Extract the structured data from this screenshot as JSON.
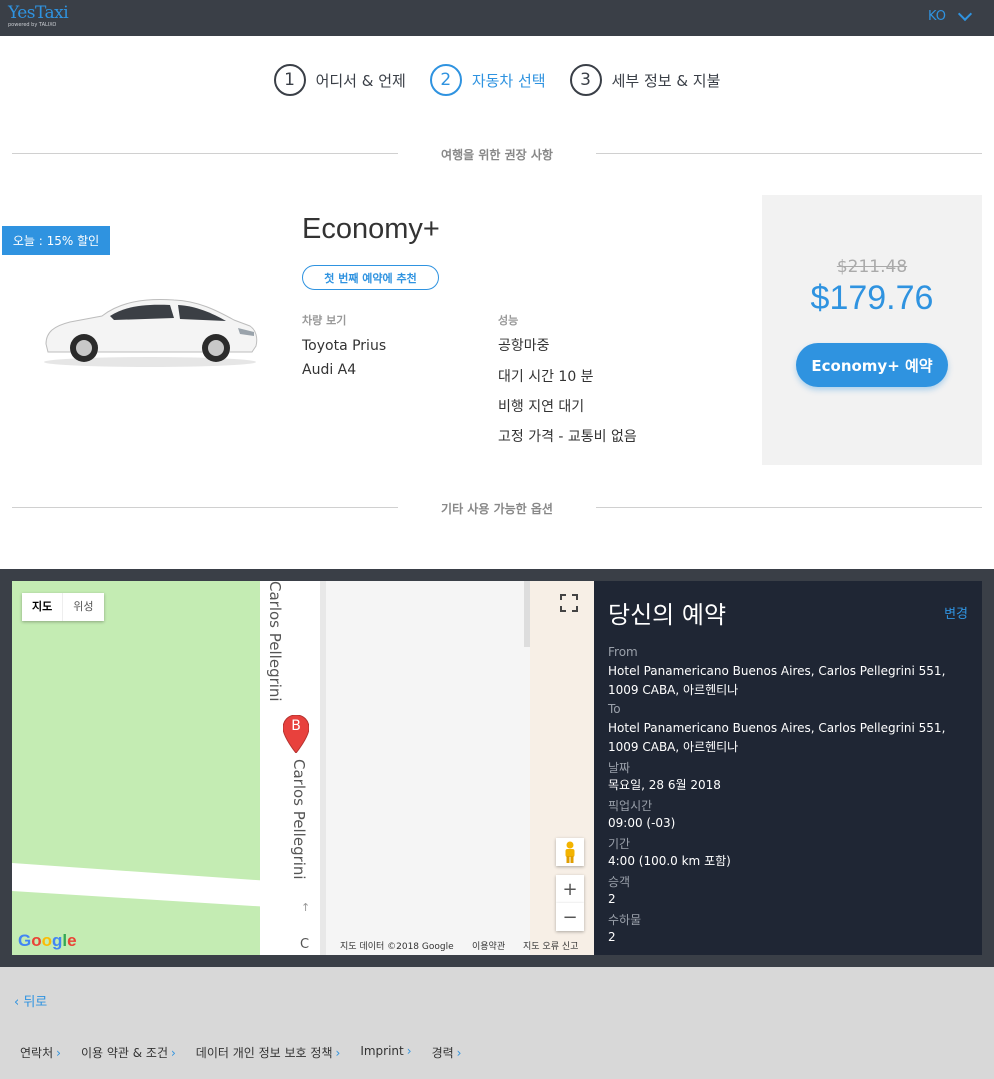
{
  "header": {
    "brand": "YesTaxi",
    "brand_sub": "powered by TALIXO",
    "language": "KO"
  },
  "steps": [
    {
      "num": "1",
      "label": "어디서 & 언제"
    },
    {
      "num": "2",
      "label": "자동차 선택"
    },
    {
      "num": "3",
      "label": "세부 정보 & 지불"
    }
  ],
  "sections": {
    "recommended": "여행을 위한 권장 사항",
    "other": "기타 사용 가능한 옵션"
  },
  "offer": {
    "discount_badge": "오늘 : 15% 할인",
    "title": "Economy+",
    "recommend_badge": "첫 번째 예약에 추천",
    "vehicles_heading": "차량 보기",
    "vehicles": [
      "Toyota Prius",
      "Audi A4"
    ],
    "features_heading": "성능",
    "features": [
      "공항마중",
      "대기 시간 10 분",
      "비행 지연 대기",
      "고정 가격 - 교통비 없음"
    ],
    "old_price": "$211.48",
    "price": "$179.76",
    "book_label": "Economy+ 예약"
  },
  "map": {
    "type_map": "지도",
    "type_satellite": "위성",
    "street_top": "Carlos Pellegrini",
    "street_bottom": "Carlos Pellegrini",
    "street_cut": "C",
    "marker": "B",
    "zoom_in": "+",
    "zoom_out": "−",
    "google": "Google",
    "map_data": "지도 데이터 ©2018 Google",
    "terms": "이용약관",
    "report": "지도 오류 신고"
  },
  "summary": {
    "title": "당신의 예약",
    "edit": "변경",
    "from_label": "From",
    "from_value": "Hotel Panamericano Buenos Aires, Carlos Pellegrini 551, 1009 CABA, 아르헨티나",
    "to_label": "To",
    "to_value": "Hotel Panamericano Buenos Aires, Carlos Pellegrini 551, 1009 CABA, 아르헨티나",
    "date_label": "날짜",
    "date_value": "목요일, 28 6월 2018",
    "pickup_label": "픽업시간",
    "pickup_value": "09:00 (-03)",
    "duration_label": "기간",
    "duration_value": "4:00 (100.0 km 포함)",
    "passengers_label": "승객",
    "passengers_value": "2",
    "luggage_label": "수하물",
    "luggage_value": "2"
  },
  "footer": {
    "back": "뒤로",
    "links": [
      "연락처",
      "이용 약관 & 조건",
      "데이터 개인 정보 보호 정책",
      "Imprint",
      "경력"
    ]
  },
  "colors": {
    "accent": "#2f93e0",
    "header_bg": "#3a3f47",
    "summary_bg": "#1f2634",
    "footer_bg": "#d8d8d8"
  }
}
